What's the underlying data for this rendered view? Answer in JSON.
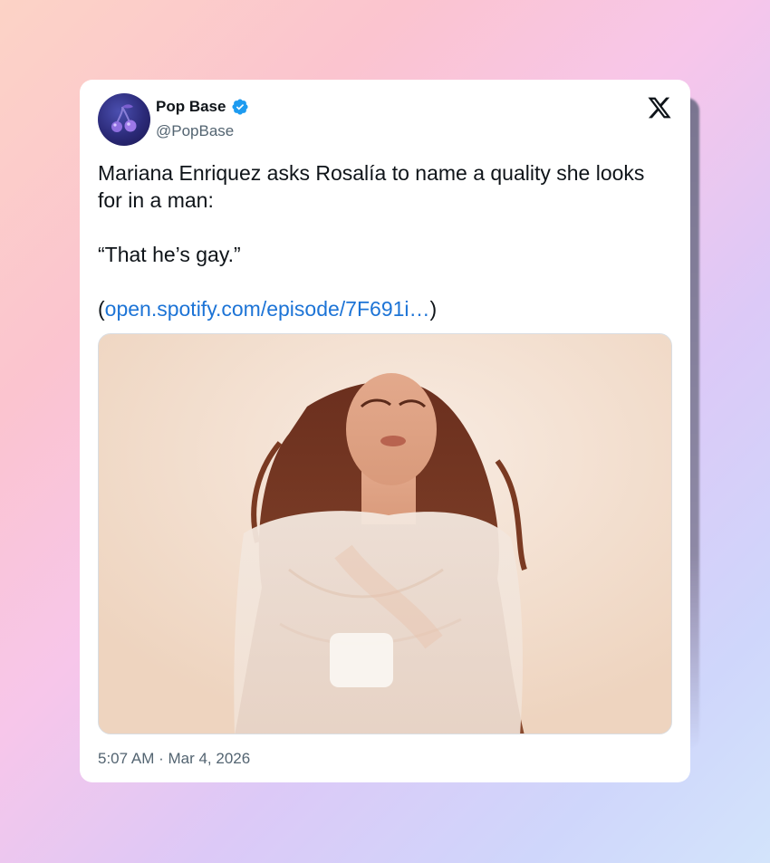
{
  "author": {
    "name": "Pop Base",
    "handle": "@PopBase",
    "verified": true,
    "avatar_icon": "cherry-icon"
  },
  "platform_icon": "x-logo-icon",
  "tweet": {
    "line1": "Mariana Enriquez asks Rosalía to name a quality she looks for in a man:",
    "quote": "“That he’s gay.”",
    "link_open": "(",
    "link_text": "open.spotify.com/episode/7F691i…",
    "link_close": ")"
  },
  "timestamp": "5:07 AM · Mar 4, 2026",
  "colors": {
    "link": "#1d74d6",
    "verified": "#1d9bf0",
    "text": "#0f1419",
    "muted": "#536471"
  }
}
